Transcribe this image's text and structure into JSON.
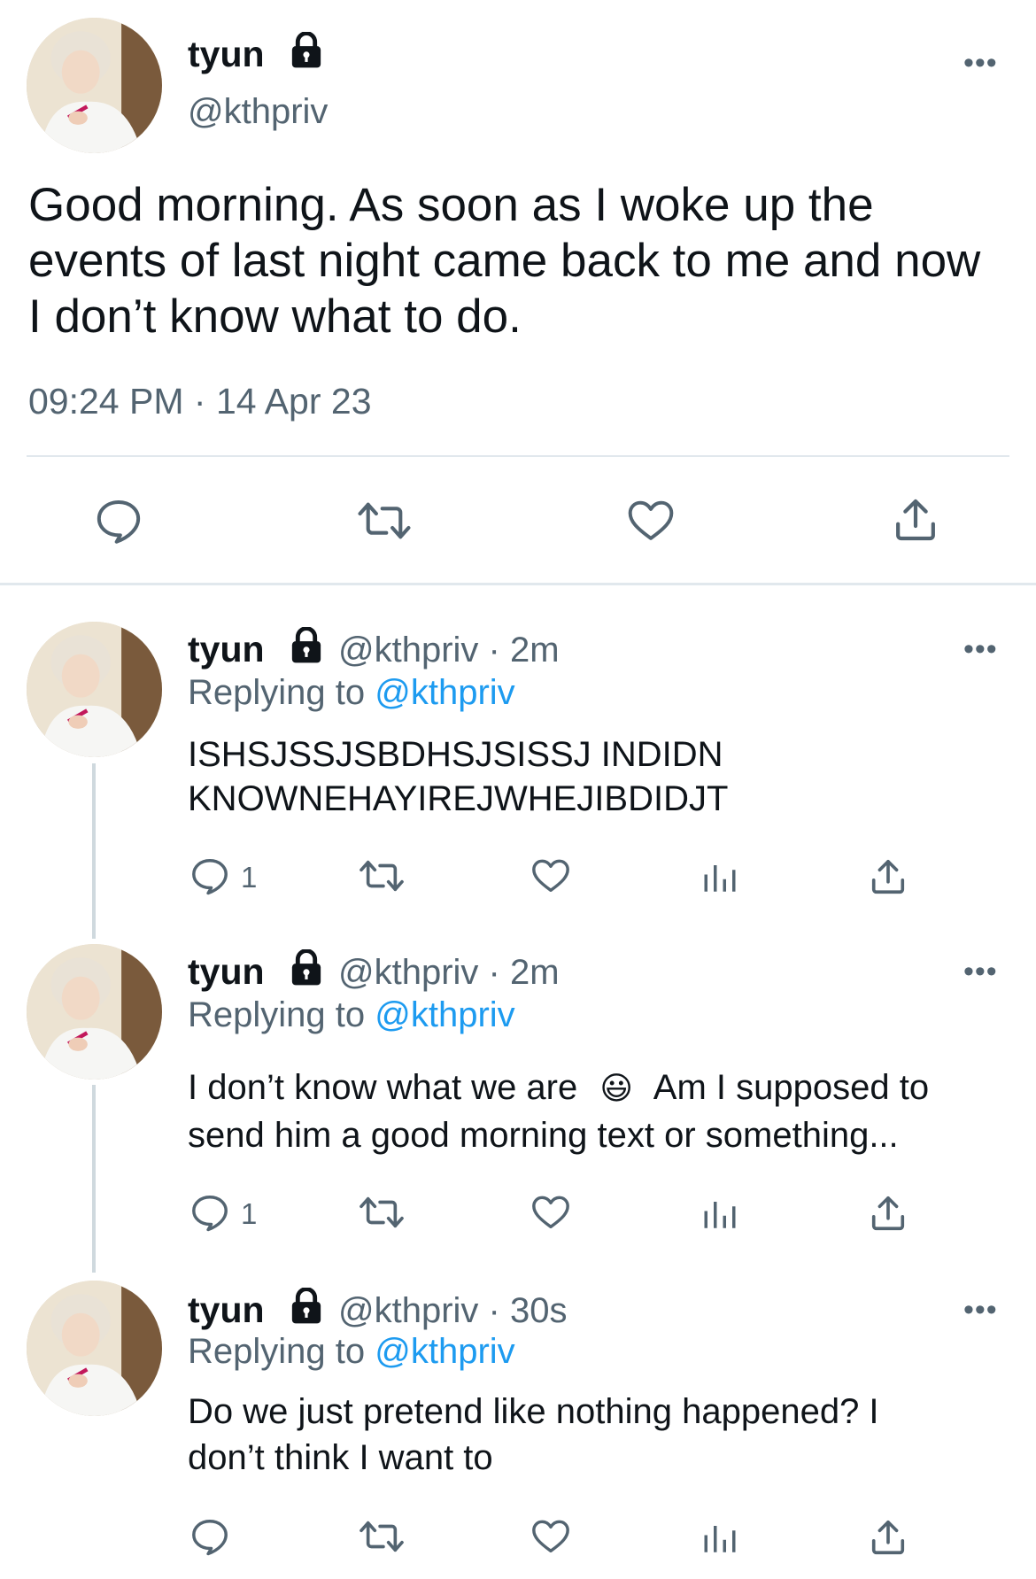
{
  "main_tweet": {
    "name": "tyun",
    "handle": "@kthpriv",
    "text": "Good morning. As soon as I woke up the events of last night came back to me and now I don’t know what to do.",
    "timestamp": "09:24 PM",
    "separator": "·",
    "date": "14 Apr 23",
    "more_label": "•••",
    "icons": [
      "reply-icon",
      "retweet-icon",
      "like-icon",
      "share-icon"
    ]
  },
  "replies": [
    {
      "name": "tyun",
      "handle_time": "@kthpriv · 2m",
      "replying_prefix": "Replying to ",
      "replying_handle": "@kthpriv",
      "text_lines": [
        "ISHSJSSJSBDHSJSISSJ INDIDN",
        "KNOWNEHAYIREJWHEJIBDIDJT"
      ],
      "reply_count": "1",
      "more_label": "•••"
    },
    {
      "name": "tyun",
      "handle_time": "@kthpriv · 2m",
      "replying_prefix": "Replying to ",
      "replying_handle": "@kthpriv",
      "text_line1_a": "I don’t know what we are",
      "emoji": "😃",
      "text_line1_b": "Am I supposed to",
      "text_line2": "send him a good morning text or something...",
      "reply_count": "1",
      "more_label": "•••"
    },
    {
      "name": "tyun",
      "handle_time": "@kthpriv · 30s",
      "replying_prefix": "Replying to ",
      "replying_handle": "@kthpriv",
      "text_lines": [
        "Do we just pretend like nothing happened? I",
        "don’t think I want to"
      ],
      "reply_count": "",
      "more_label": "•••"
    }
  ],
  "colors": {
    "text": "#0f1419",
    "secondary": "#536471",
    "link": "#1d9bf0",
    "divider": "#e1e8ed"
  }
}
